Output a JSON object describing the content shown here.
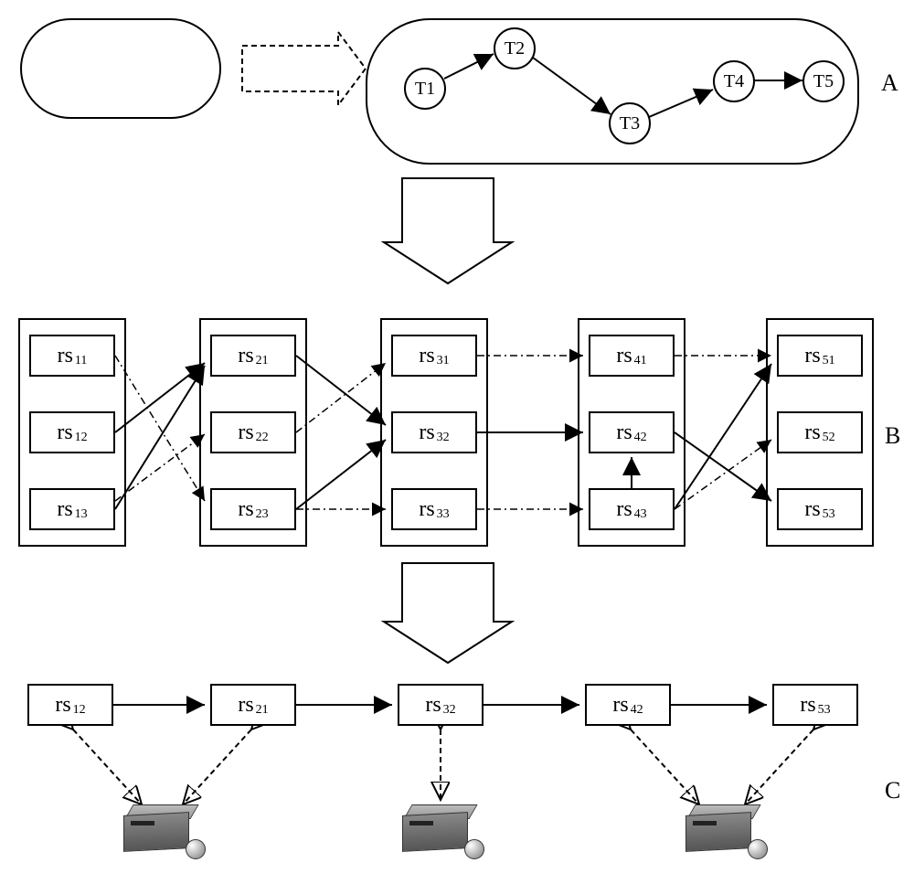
{
  "section_labels": {
    "a": "A",
    "b": "B",
    "c": "C"
  },
  "task_nodes": {
    "t1": "T1",
    "t2": "T2",
    "t3": "T3",
    "t4": "T4",
    "t5": "T5"
  },
  "task_edges": [
    {
      "from": "T1",
      "to": "T2"
    },
    {
      "from": "T2",
      "to": "T3"
    },
    {
      "from": "T3",
      "to": "T4"
    },
    {
      "from": "T4",
      "to": "T5"
    }
  ],
  "rs_prefix": "rs",
  "columns": [
    [
      "11",
      "12",
      "13"
    ],
    [
      "21",
      "22",
      "23"
    ],
    [
      "31",
      "32",
      "33"
    ],
    [
      "41",
      "42",
      "43"
    ],
    [
      "51",
      "52",
      "53"
    ]
  ],
  "b_edges_solid": [
    {
      "from": "rs12",
      "to": "rs21"
    },
    {
      "from": "rs13",
      "to": "rs21"
    },
    {
      "from": "rs21",
      "to": "rs32"
    },
    {
      "from": "rs23",
      "to": "rs32"
    },
    {
      "from": "rs32",
      "to": "rs42"
    },
    {
      "from": "rs43",
      "to": "rs42"
    },
    {
      "from": "rs42",
      "to": "rs53"
    },
    {
      "from": "rs43",
      "to": "rs51"
    }
  ],
  "b_edges_dashed": [
    {
      "from": "rs11",
      "to": "rs23"
    },
    {
      "from": "rs13",
      "to": "rs22"
    },
    {
      "from": "rs22",
      "to": "rs31"
    },
    {
      "from": "rs23",
      "to": "rs33"
    },
    {
      "from": "rs31",
      "to": "rs41"
    },
    {
      "from": "rs33",
      "to": "rs43"
    },
    {
      "from": "rs41",
      "to": "rs51"
    },
    {
      "from": "rs43",
      "to": "rs52"
    }
  ],
  "selected_chain": [
    "12",
    "21",
    "32",
    "42",
    "53"
  ],
  "chain_edges": [
    {
      "from": "rs12",
      "to": "rs21"
    },
    {
      "from": "rs21",
      "to": "rs32"
    },
    {
      "from": "rs32",
      "to": "rs42"
    },
    {
      "from": "rs42",
      "to": "rs53"
    }
  ],
  "servers": 3,
  "server_mapping": [
    {
      "server": 1,
      "nodes": [
        "rs12",
        "rs21"
      ]
    },
    {
      "server": 2,
      "nodes": [
        "rs32"
      ]
    },
    {
      "server": 3,
      "nodes": [
        "rs42",
        "rs53"
      ]
    }
  ]
}
